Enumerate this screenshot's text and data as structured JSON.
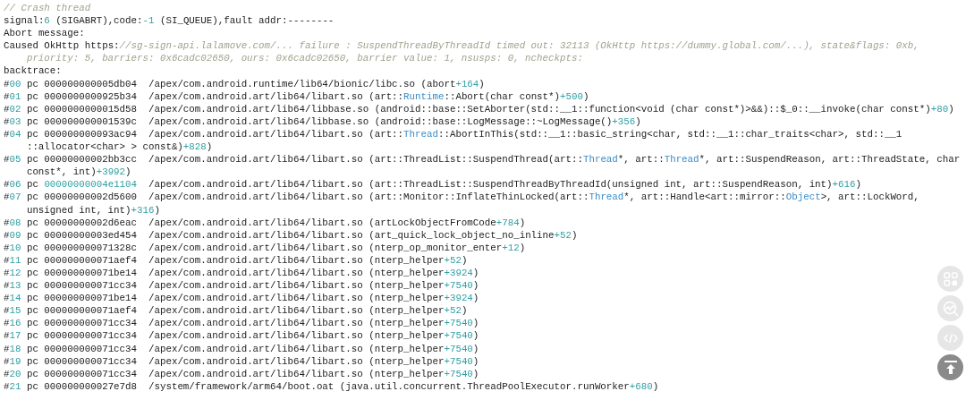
{
  "code_lines": [
    {
      "wrapped": false,
      "segments": [
        {
          "text": "// Crash thread",
          "kind": "comment"
        }
      ]
    },
    {
      "wrapped": false,
      "segments": [
        {
          "text": "signal:",
          "kind": "plain"
        },
        {
          "text": "6",
          "kind": "number"
        },
        {
          "text": " (SIGABRT),code:",
          "kind": "plain"
        },
        {
          "text": "-1",
          "kind": "number"
        },
        {
          "text": " (SI_QUEUE),fault addr:--------",
          "kind": "plain"
        }
      ]
    },
    {
      "wrapped": false,
      "segments": [
        {
          "text": "Abort message:",
          "kind": "plain"
        }
      ]
    },
    {
      "wrapped": false,
      "segments": [
        {
          "text": "Caused OkHttp https:",
          "kind": "plain"
        },
        {
          "text": "//sg-sign-api.lalamove.com/... failure : SuspendThreadByThreadId timed out: 32113 (OkHttp https://dummy.global.com/...), state&flags: 0xb,",
          "kind": "comment"
        }
      ]
    },
    {
      "wrapped": true,
      "segments": [
        {
          "text": "priority: 5, barriers: 0x6cadc02650, ours: 0x6cadc02650, barrier value: 1, nsusps: 0, ncheckpts:",
          "kind": "comment"
        }
      ]
    },
    {
      "wrapped": false,
      "segments": [
        {
          "text": "backtrace:",
          "kind": "plain"
        }
      ]
    },
    {
      "wrapped": false,
      "segments": [
        {
          "text": "#",
          "kind": "plain"
        },
        {
          "text": "00",
          "kind": "number"
        },
        {
          "text": " pc 000000000005db04  /apex/com.android.runtime/lib64/bionic/libc.so (abort",
          "kind": "plain"
        },
        {
          "text": "+164",
          "kind": "number"
        },
        {
          "text": ")",
          "kind": "plain"
        }
      ]
    },
    {
      "wrapped": false,
      "segments": [
        {
          "text": "#",
          "kind": "plain"
        },
        {
          "text": "01",
          "kind": "number"
        },
        {
          "text": " pc 0000000000925b34  /apex/com.android.art/lib64/libart.so (art::",
          "kind": "plain"
        },
        {
          "text": "Runtime",
          "kind": "type"
        },
        {
          "text": "::Abort(char const*)",
          "kind": "plain"
        },
        {
          "text": "+500",
          "kind": "number"
        },
        {
          "text": ")",
          "kind": "plain"
        }
      ]
    },
    {
      "wrapped": false,
      "segments": [
        {
          "text": "#",
          "kind": "plain"
        },
        {
          "text": "02",
          "kind": "number"
        },
        {
          "text": " pc 0000000000015d58  /apex/com.android.art/lib64/libbase.so (android::base::SetAborter(std::__1::function<void (char const*)>&&)::$_0::__invoke(char const*)",
          "kind": "plain"
        },
        {
          "text": "+80",
          "kind": "number"
        },
        {
          "text": ")",
          "kind": "plain"
        }
      ]
    },
    {
      "wrapped": false,
      "segments": [
        {
          "text": "#",
          "kind": "plain"
        },
        {
          "text": "03",
          "kind": "number"
        },
        {
          "text": " pc 000000000001539c  /apex/com.android.art/lib64/libbase.so (android::base::LogMessage::~LogMessage()",
          "kind": "plain"
        },
        {
          "text": "+356",
          "kind": "number"
        },
        {
          "text": ")",
          "kind": "plain"
        }
      ]
    },
    {
      "wrapped": false,
      "segments": [
        {
          "text": "#",
          "kind": "plain"
        },
        {
          "text": "04",
          "kind": "number"
        },
        {
          "text": " pc 000000000093ac94  /apex/com.android.art/lib64/libart.so (art::",
          "kind": "plain"
        },
        {
          "text": "Thread",
          "kind": "type"
        },
        {
          "text": "::AbortInThis(std::__1::basic_string<char, std::__1::char_traits<char>, std::__1",
          "kind": "plain"
        }
      ]
    },
    {
      "wrapped": true,
      "segments": [
        {
          "text": "::allocator<char> > const&)",
          "kind": "plain"
        },
        {
          "text": "+828",
          "kind": "number"
        },
        {
          "text": ")",
          "kind": "plain"
        }
      ]
    },
    {
      "wrapped": false,
      "segments": [
        {
          "text": "#",
          "kind": "plain"
        },
        {
          "text": "05",
          "kind": "number"
        },
        {
          "text": " pc 00000000002bb3cc  /apex/com.android.art/lib64/libart.so (art::ThreadList::SuspendThread(art::",
          "kind": "plain"
        },
        {
          "text": "Thread",
          "kind": "type"
        },
        {
          "text": "*, art::",
          "kind": "plain"
        },
        {
          "text": "Thread",
          "kind": "type"
        },
        {
          "text": "*, art::SuspendReason, art::ThreadState, char",
          "kind": "plain"
        }
      ]
    },
    {
      "wrapped": true,
      "segments": [
        {
          "text": "const*, int)",
          "kind": "plain"
        },
        {
          "text": "+3992",
          "kind": "number"
        },
        {
          "text": ")",
          "kind": "plain"
        }
      ]
    },
    {
      "wrapped": false,
      "segments": [
        {
          "text": "#",
          "kind": "plain"
        },
        {
          "text": "06",
          "kind": "number"
        },
        {
          "text": " pc ",
          "kind": "plain"
        },
        {
          "text": "00000000004e1104",
          "kind": "number"
        },
        {
          "text": "  /apex/com.android.art/lib64/libart.so (art::ThreadList::SuspendThreadByThreadId(unsigned int, art::SuspendReason, int)",
          "kind": "plain"
        },
        {
          "text": "+616",
          "kind": "number"
        },
        {
          "text": ")",
          "kind": "plain"
        }
      ]
    },
    {
      "wrapped": false,
      "segments": [
        {
          "text": "#",
          "kind": "plain"
        },
        {
          "text": "07",
          "kind": "number"
        },
        {
          "text": " pc 00000000002d5600  /apex/com.android.art/lib64/libart.so (art::Monitor::InflateThinLocked(art::",
          "kind": "plain"
        },
        {
          "text": "Thread",
          "kind": "type"
        },
        {
          "text": "*, art::Handle<art::mirror::",
          "kind": "plain"
        },
        {
          "text": "Object",
          "kind": "type"
        },
        {
          "text": ">, art::LockWord,",
          "kind": "plain"
        }
      ]
    },
    {
      "wrapped": true,
      "segments": [
        {
          "text": "unsigned int, int)",
          "kind": "plain"
        },
        {
          "text": "+316",
          "kind": "number"
        },
        {
          "text": ")",
          "kind": "plain"
        }
      ]
    },
    {
      "wrapped": false,
      "segments": [
        {
          "text": "#",
          "kind": "plain"
        },
        {
          "text": "08",
          "kind": "number"
        },
        {
          "text": " pc 00000000002d6eac  /apex/com.android.art/lib64/libart.so (artLockObjectFromCode",
          "kind": "plain"
        },
        {
          "text": "+784",
          "kind": "number"
        },
        {
          "text": ")",
          "kind": "plain"
        }
      ]
    },
    {
      "wrapped": false,
      "segments": [
        {
          "text": "#",
          "kind": "plain"
        },
        {
          "text": "09",
          "kind": "number"
        },
        {
          "text": " pc 00000000003ed454  /apex/com.android.art/lib64/libart.so (art_quick_lock_object_no_inline",
          "kind": "plain"
        },
        {
          "text": "+52",
          "kind": "number"
        },
        {
          "text": ")",
          "kind": "plain"
        }
      ]
    },
    {
      "wrapped": false,
      "segments": [
        {
          "text": "#",
          "kind": "plain"
        },
        {
          "text": "10",
          "kind": "number"
        },
        {
          "text": " pc 000000000071328c  /apex/com.android.art/lib64/libart.so (nterp_op_monitor_enter",
          "kind": "plain"
        },
        {
          "text": "+12",
          "kind": "number"
        },
        {
          "text": ")",
          "kind": "plain"
        }
      ]
    },
    {
      "wrapped": false,
      "segments": [
        {
          "text": "#",
          "kind": "plain"
        },
        {
          "text": "11",
          "kind": "number"
        },
        {
          "text": " pc 000000000071aef4  /apex/com.android.art/lib64/libart.so (nterp_helper",
          "kind": "plain"
        },
        {
          "text": "+52",
          "kind": "number"
        },
        {
          "text": ")",
          "kind": "plain"
        }
      ]
    },
    {
      "wrapped": false,
      "segments": [
        {
          "text": "#",
          "kind": "plain"
        },
        {
          "text": "12",
          "kind": "number"
        },
        {
          "text": " pc 000000000071be14  /apex/com.android.art/lib64/libart.so (nterp_helper",
          "kind": "plain"
        },
        {
          "text": "+3924",
          "kind": "number"
        },
        {
          "text": ")",
          "kind": "plain"
        }
      ]
    },
    {
      "wrapped": false,
      "segments": [
        {
          "text": "#",
          "kind": "plain"
        },
        {
          "text": "13",
          "kind": "number"
        },
        {
          "text": " pc 000000000071cc34  /apex/com.android.art/lib64/libart.so (nterp_helper",
          "kind": "plain"
        },
        {
          "text": "+7540",
          "kind": "number"
        },
        {
          "text": ")",
          "kind": "plain"
        }
      ]
    },
    {
      "wrapped": false,
      "segments": [
        {
          "text": "#",
          "kind": "plain"
        },
        {
          "text": "14",
          "kind": "number"
        },
        {
          "text": " pc 000000000071be14  /apex/com.android.art/lib64/libart.so (nterp_helper",
          "kind": "plain"
        },
        {
          "text": "+3924",
          "kind": "number"
        },
        {
          "text": ")",
          "kind": "plain"
        }
      ]
    },
    {
      "wrapped": false,
      "segments": [
        {
          "text": "#",
          "kind": "plain"
        },
        {
          "text": "15",
          "kind": "number"
        },
        {
          "text": " pc 000000000071aef4  /apex/com.android.art/lib64/libart.so (nterp_helper",
          "kind": "plain"
        },
        {
          "text": "+52",
          "kind": "number"
        },
        {
          "text": ")",
          "kind": "plain"
        }
      ]
    },
    {
      "wrapped": false,
      "segments": [
        {
          "text": "#",
          "kind": "plain"
        },
        {
          "text": "16",
          "kind": "number"
        },
        {
          "text": " pc 000000000071cc34  /apex/com.android.art/lib64/libart.so (nterp_helper",
          "kind": "plain"
        },
        {
          "text": "+7540",
          "kind": "number"
        },
        {
          "text": ")",
          "kind": "plain"
        }
      ]
    },
    {
      "wrapped": false,
      "segments": [
        {
          "text": "#",
          "kind": "plain"
        },
        {
          "text": "17",
          "kind": "number"
        },
        {
          "text": " pc 000000000071cc34  /apex/com.android.art/lib64/libart.so (nterp_helper",
          "kind": "plain"
        },
        {
          "text": "+7540",
          "kind": "number"
        },
        {
          "text": ")",
          "kind": "plain"
        }
      ]
    },
    {
      "wrapped": false,
      "segments": [
        {
          "text": "#",
          "kind": "plain"
        },
        {
          "text": "18",
          "kind": "number"
        },
        {
          "text": " pc 000000000071cc34  /apex/com.android.art/lib64/libart.so (nterp_helper",
          "kind": "plain"
        },
        {
          "text": "+7540",
          "kind": "number"
        },
        {
          "text": ")",
          "kind": "plain"
        }
      ]
    },
    {
      "wrapped": false,
      "segments": [
        {
          "text": "#",
          "kind": "plain"
        },
        {
          "text": "19",
          "kind": "number"
        },
        {
          "text": " pc 000000000071cc34  /apex/com.android.art/lib64/libart.so (nterp_helper",
          "kind": "plain"
        },
        {
          "text": "+7540",
          "kind": "number"
        },
        {
          "text": ")",
          "kind": "plain"
        }
      ]
    },
    {
      "wrapped": false,
      "segments": [
        {
          "text": "#",
          "kind": "plain"
        },
        {
          "text": "20",
          "kind": "number"
        },
        {
          "text": " pc 000000000071cc34  /apex/com.android.art/lib64/libart.so (nterp_helper",
          "kind": "plain"
        },
        {
          "text": "+7540",
          "kind": "number"
        },
        {
          "text": ")",
          "kind": "plain"
        }
      ]
    },
    {
      "wrapped": false,
      "segments": [
        {
          "text": "#",
          "kind": "plain"
        },
        {
          "text": "21",
          "kind": "number"
        },
        {
          "text": " pc 000000000027e7d8  /system/framework/arm64/boot.oat (java.util.concurrent.ThreadPoolExecutor.runWorker",
          "kind": "plain"
        },
        {
          "text": "+680",
          "kind": "number"
        },
        {
          "text": ")",
          "kind": "plain"
        }
      ]
    }
  ]
}
